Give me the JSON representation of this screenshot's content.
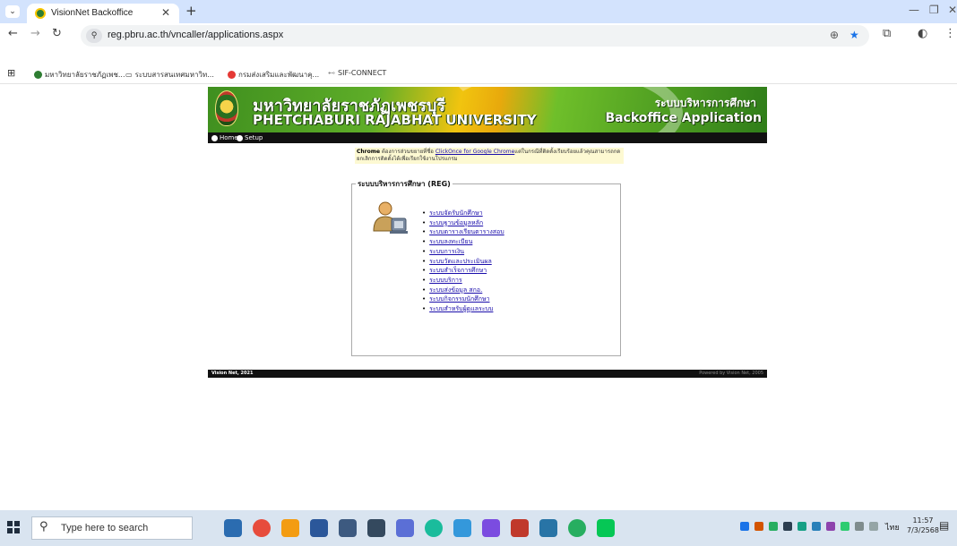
{
  "browser": {
    "tab_title": "VisionNet Backoffice",
    "url": "reg.pbru.ac.th/vncaller/applications.aspx",
    "bookmarks": [
      "มหาวิทยาลัยราชภัฏเพช...",
      "ระบบสารสนเทศมหาวิท...",
      "กรมส่งเสริมและพัฒนาคุ...",
      "SIF-CONNECT"
    ]
  },
  "banner": {
    "title_th": "มหาวิทยาลัยราชภัฏเพชรบุรี",
    "title_en": "PHETCHABURI RAJABHAT UNIVERSITY",
    "right_th": "ระบบบริหารการศึกษา",
    "right_en": "Backoffice Application"
  },
  "menu": {
    "home": "Home",
    "setup": "Setup"
  },
  "notice": {
    "bold": "Chrome",
    "text1": " ต้องการส่วนขยายที่ชื่อ ",
    "link": "ClickOnce for Google Chrome",
    "text2": "แต่ในกรณีที่ติดตั้งเรียบร้อยแล้วคุณสามารถกดยกเลิกการติดตั้งได้เพื่อเรียกใช้งานโปรแกรม"
  },
  "section": {
    "legend": "ระบบบริหารการศึกษา (REG)",
    "links": [
      "ระบบจัดรับนักศึกษา",
      "ระบบฐานข้อมูลหลัก",
      "ระบบตารางเรียนตารางสอบ",
      "ระบบลงทะเบียน",
      "ระบบการเงิน",
      "ระบบวัดและประเมินผล",
      "ระบบสำเร็จการศึกษา",
      "ระบบบริการ",
      "ระบบส่งข้อมูล สกอ.",
      "ระบบกิจกรรมนักศึกษา",
      "ระบบสำหรับผู้ดูแลระบบ"
    ]
  },
  "footer": {
    "left": "Vision Net, 2021",
    "right": "Powered by Vision Net, 2005"
  },
  "taskbar": {
    "search_placeholder": "Type here to search",
    "lang": "ไทย",
    "time": "11:57",
    "date": "7/3/2568"
  },
  "colors": {
    "tabbar": "#d3e3fd",
    "banner_green": "#3f8f1f",
    "link": "#1a0dab",
    "taskbar": "#d9e4f0"
  }
}
